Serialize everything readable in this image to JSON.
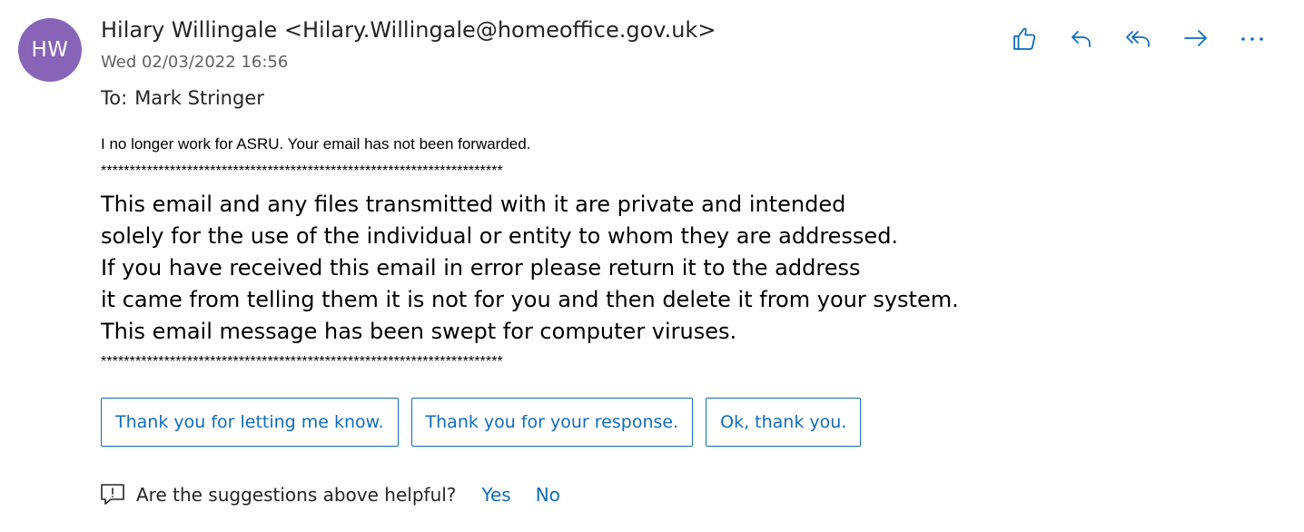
{
  "sender": {
    "initials": "HW",
    "avatar_color": "#8764b8",
    "display": "Hilary Willingale <Hilary.Willingale@homeoffice.gov.uk>",
    "date": "Wed 02/03/2022 16:56"
  },
  "recipients": {
    "label": "To:",
    "name": "Mark Stringer"
  },
  "actions": [
    {
      "name": "like-icon"
    },
    {
      "name": "reply-icon"
    },
    {
      "name": "reply-all-icon"
    },
    {
      "name": "forward-icon"
    },
    {
      "name": "more-actions-icon"
    }
  ],
  "body": {
    "notice": "I no longer work for ASRU. Your email has not been forwarded.",
    "separator": "**********************************************************************",
    "disclaimer": [
      "This email and any files transmitted with it are private and intended",
      "solely for the use of the individual or entity to whom they are addressed.",
      "If you have received this email in error please return it to the address",
      "it came from telling them it is not for you and then delete it from your system.",
      "This email message has been swept for computer viruses."
    ]
  },
  "suggested_replies": [
    "Thank you for letting me know.",
    "Thank you for your response.",
    "Ok, thank you."
  ],
  "feedback": {
    "question": "Are the suggestions above helpful?",
    "yes": "Yes",
    "no": "No"
  },
  "colors": {
    "accent": "#0f6cbd",
    "text": "#242424",
    "secondary_text": "#616161"
  }
}
